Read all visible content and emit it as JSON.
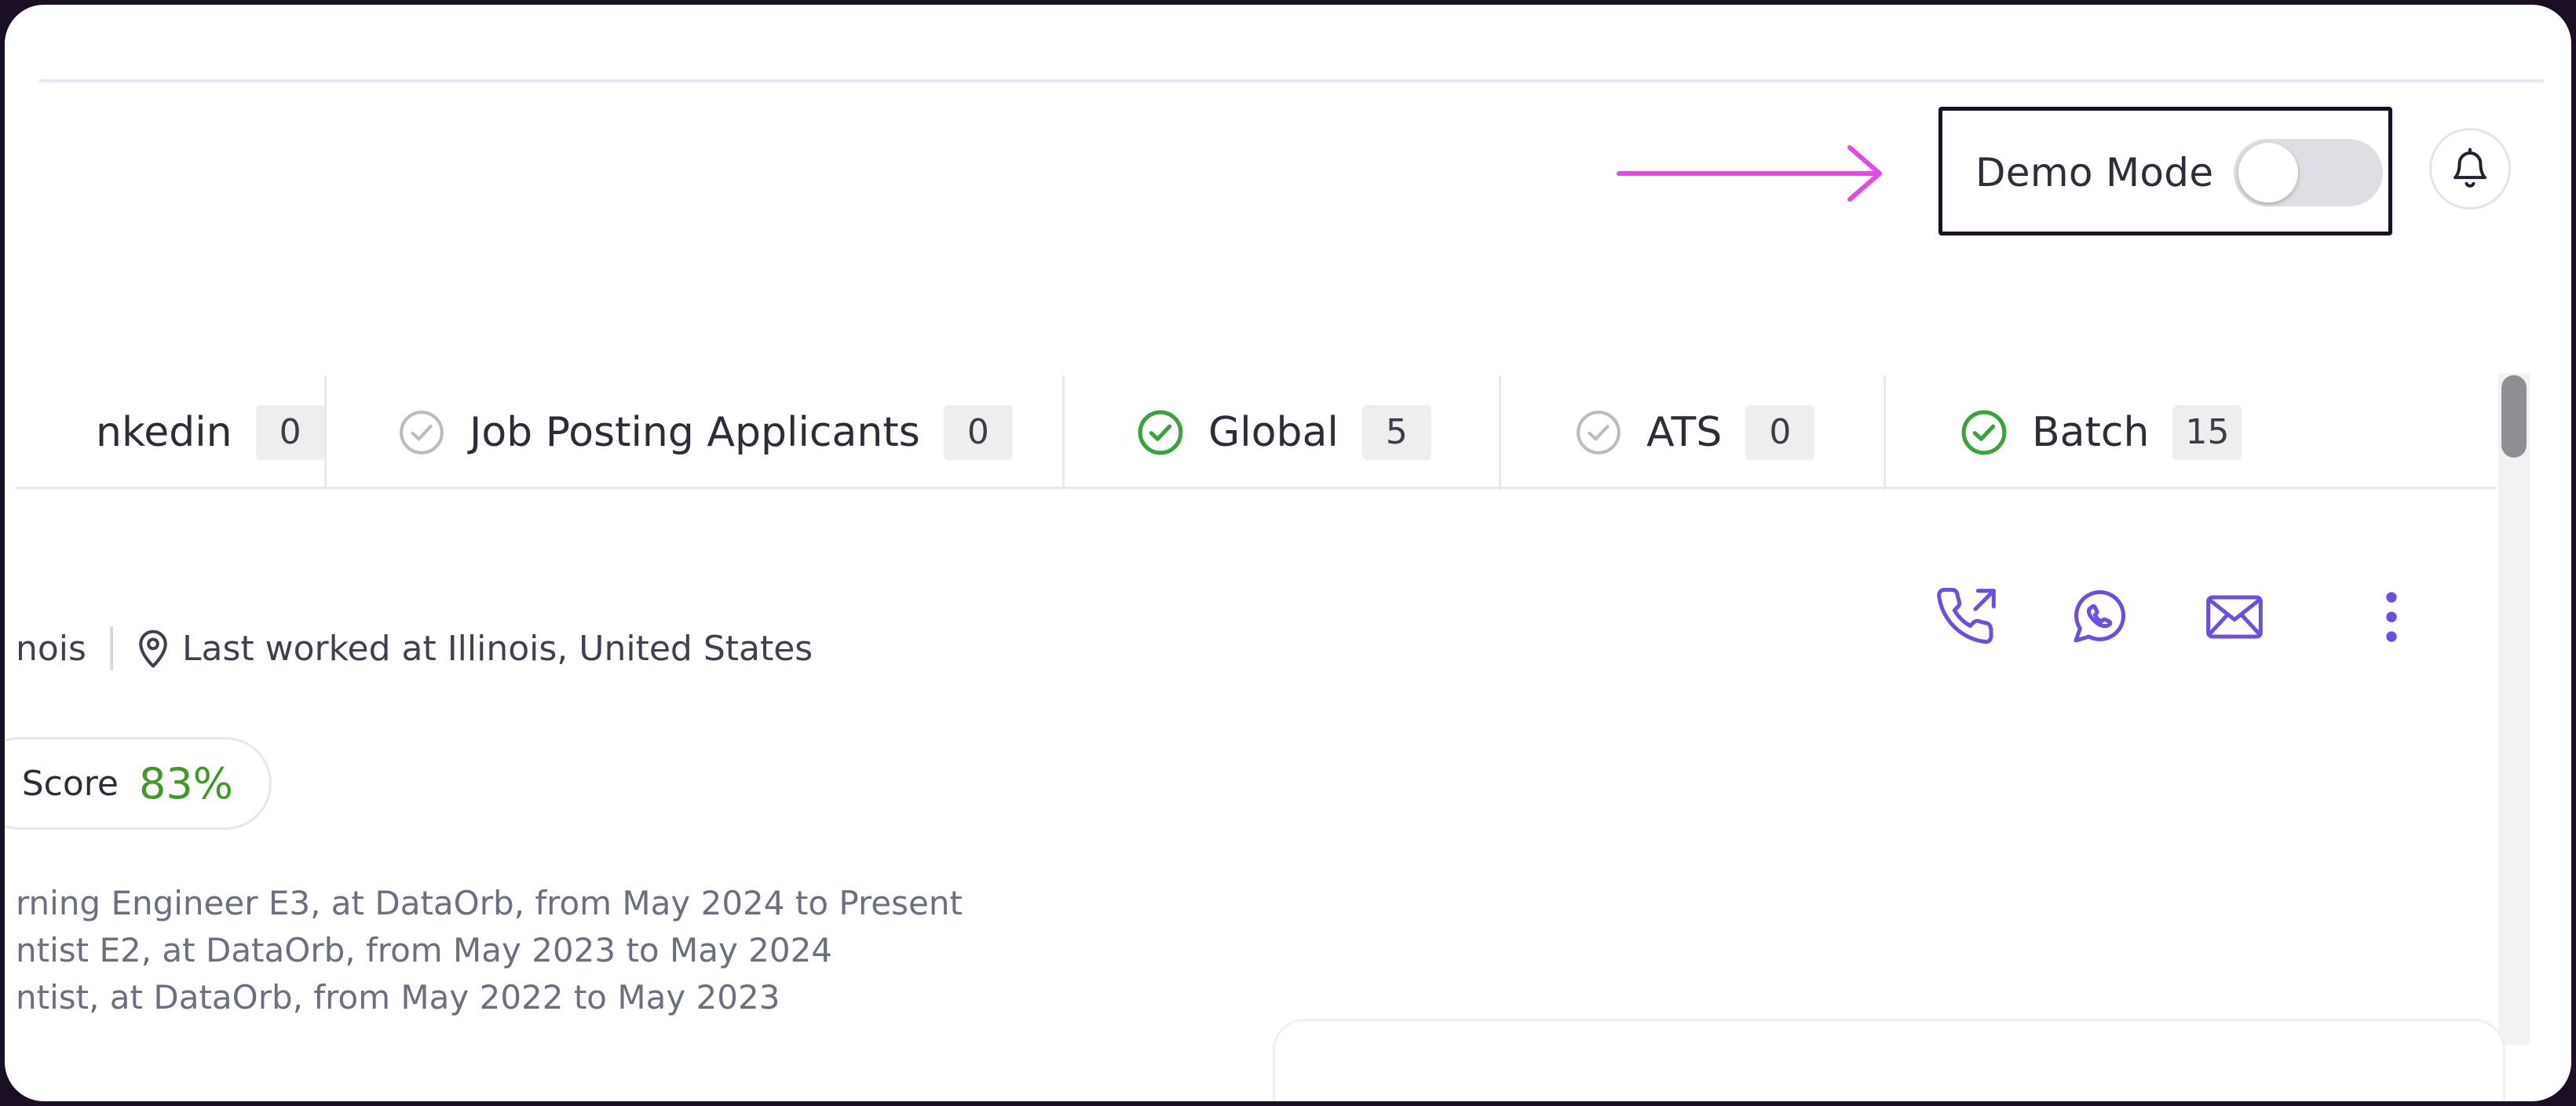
{
  "header": {
    "demo_mode_label": "Demo Mode",
    "demo_mode_on": false
  },
  "tabs": [
    {
      "label": "nkedin",
      "count": "0",
      "icon": "none"
    },
    {
      "label": "Job Posting Applicants",
      "count": "0",
      "icon": "check-circle-gray"
    },
    {
      "label": "Global",
      "count": "5",
      "icon": "check-circle-green"
    },
    {
      "label": "ATS",
      "count": "0",
      "icon": "check-circle-gray"
    },
    {
      "label": "Batch",
      "count": "15",
      "icon": "check-circle-green"
    }
  ],
  "candidate": {
    "location_prefix": "nois",
    "location": "Last worked at Illinois, United States",
    "score_label": "Score",
    "score_value": "83%",
    "experience": [
      "rning Engineer E3, at DataOrb, from May 2024 to Present",
      "ntist E2, at DataOrb, from May 2023 to May 2024",
      "ntist, at DataOrb, from May 2022 to May 2023"
    ]
  },
  "contact_icons": [
    "phone-call-icon",
    "whatsapp-icon",
    "email-icon",
    "more-vertical-icon"
  ],
  "colors": {
    "accent": "#6b4ee6",
    "arrow": "#e04be8",
    "success": "#3f9a2a",
    "check_gray": "#b9bcc4",
    "check_green": "#3aa33f"
  }
}
